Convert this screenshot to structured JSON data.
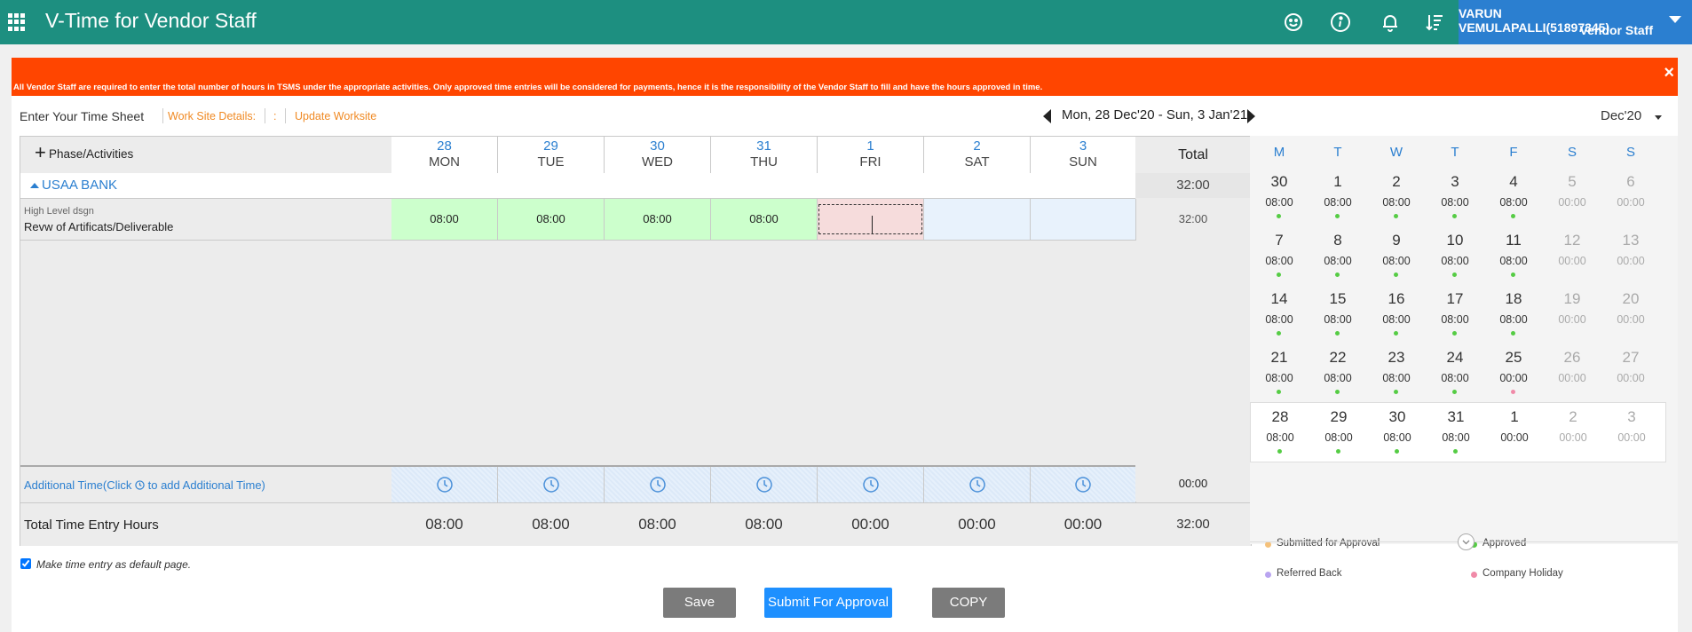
{
  "header": {
    "title": "V-Time for Vendor Staff",
    "user_name": "VARUN VEMULAPALLI(51897345)",
    "user_role": "Vendor Staff",
    "icons": [
      "apps-grid-icon",
      "smiley-icon",
      "info-icon",
      "bell-icon",
      "sort-list-icon",
      "caret-down-icon"
    ],
    "color": "#1d8f80",
    "user_box_color": "#2b7fd0"
  },
  "banner": {
    "text": "All Vendor Staff are required to enter the total number of hours in TSMS under the appropriate activities. Only approved time entries will be considered for payments, hence it is the responsibility of the Vendor Staff to fill and have the hours approved in time.",
    "close": "×",
    "color": "#ff4500"
  },
  "toolbar": {
    "label": "Enter Your Time Sheet",
    "worksite_label": "Work Site Details:",
    "colon": ":",
    "update_worksite": "Update Worksite",
    "week_range": "Mon, 28 Dec'20 - Sun, 3 Jan'21",
    "month": "Dec'20"
  },
  "grid": {
    "phase_header": "Phase/Activities",
    "total_header": "Total",
    "days": [
      {
        "num": "28",
        "name": "MON"
      },
      {
        "num": "29",
        "name": "TUE"
      },
      {
        "num": "30",
        "name": "WED"
      },
      {
        "num": "31",
        "name": "THU"
      },
      {
        "num": "1",
        "name": "FRI"
      },
      {
        "num": "2",
        "name": "SAT"
      },
      {
        "num": "3",
        "name": "SUN"
      }
    ],
    "project": {
      "name": "USAA BANK",
      "total": "32:00"
    },
    "activity": {
      "sub": "High Level dsgn",
      "name": "Revw of Artificats/Deliverable",
      "hours": [
        "08:00",
        "08:00",
        "08:00",
        "08:00",
        "",
        "",
        ""
      ],
      "total": "32:00"
    },
    "additional_label_prefix": "Additional Time(Click",
    "additional_label_suffix": "to add Additional Time)",
    "additional_total": "00:00",
    "total_label": "Total Time Entry Hours",
    "day_totals": [
      "08:00",
      "08:00",
      "08:00",
      "08:00",
      "00:00",
      "00:00",
      "00:00"
    ],
    "grand_total": "32:00"
  },
  "calendar": {
    "dow": [
      "M",
      "T",
      "W",
      "T",
      "F",
      "S",
      "S"
    ],
    "weeks": [
      [
        {
          "d": "30",
          "h": "08:00",
          "s": "approved"
        },
        {
          "d": "1",
          "h": "08:00",
          "s": "approved"
        },
        {
          "d": "2",
          "h": "08:00",
          "s": "approved"
        },
        {
          "d": "3",
          "h": "08:00",
          "s": "approved"
        },
        {
          "d": "4",
          "h": "08:00",
          "s": "approved"
        },
        {
          "d": "5",
          "h": "00:00",
          "s": ""
        },
        {
          "d": "6",
          "h": "00:00",
          "s": ""
        }
      ],
      [
        {
          "d": "7",
          "h": "08:00",
          "s": "approved"
        },
        {
          "d": "8",
          "h": "08:00",
          "s": "approved"
        },
        {
          "d": "9",
          "h": "08:00",
          "s": "approved"
        },
        {
          "d": "10",
          "h": "08:00",
          "s": "approved"
        },
        {
          "d": "11",
          "h": "08:00",
          "s": "approved"
        },
        {
          "d": "12",
          "h": "00:00",
          "s": ""
        },
        {
          "d": "13",
          "h": "00:00",
          "s": ""
        }
      ],
      [
        {
          "d": "14",
          "h": "08:00",
          "s": "approved"
        },
        {
          "d": "15",
          "h": "08:00",
          "s": "approved"
        },
        {
          "d": "16",
          "h": "08:00",
          "s": "approved"
        },
        {
          "d": "17",
          "h": "08:00",
          "s": "approved"
        },
        {
          "d": "18",
          "h": "08:00",
          "s": "approved"
        },
        {
          "d": "19",
          "h": "00:00",
          "s": ""
        },
        {
          "d": "20",
          "h": "00:00",
          "s": ""
        }
      ],
      [
        {
          "d": "21",
          "h": "08:00",
          "s": "approved"
        },
        {
          "d": "22",
          "h": "08:00",
          "s": "approved"
        },
        {
          "d": "23",
          "h": "08:00",
          "s": "approved"
        },
        {
          "d": "24",
          "h": "08:00",
          "s": "approved"
        },
        {
          "d": "25",
          "h": "00:00",
          "s": "holiday"
        },
        {
          "d": "26",
          "h": "00:00",
          "s": ""
        },
        {
          "d": "27",
          "h": "00:00",
          "s": ""
        }
      ],
      [
        {
          "d": "28",
          "h": "08:00",
          "s": "approved"
        },
        {
          "d": "29",
          "h": "08:00",
          "s": "approved"
        },
        {
          "d": "30",
          "h": "08:00",
          "s": "approved"
        },
        {
          "d": "31",
          "h": "08:00",
          "s": "approved"
        },
        {
          "d": "1",
          "h": "00:00",
          "s": ""
        },
        {
          "d": "2",
          "h": "00:00",
          "s": ""
        },
        {
          "d": "3",
          "h": "00:00",
          "s": ""
        }
      ]
    ],
    "legend": {
      "submitted": "Submitted for Approval",
      "approved": "Approved",
      "referred": "Referred Back",
      "holiday": "Company Holiday"
    },
    "colors": {
      "submitted": "#f5c17a",
      "approved": "#55cc44",
      "referred": "#b9a4f0",
      "holiday": "#f08aa8"
    }
  },
  "footer": {
    "default_label": "Make time entry as default page.",
    "save": "Save",
    "submit": "Submit For Approval",
    "copy": "COPY"
  }
}
